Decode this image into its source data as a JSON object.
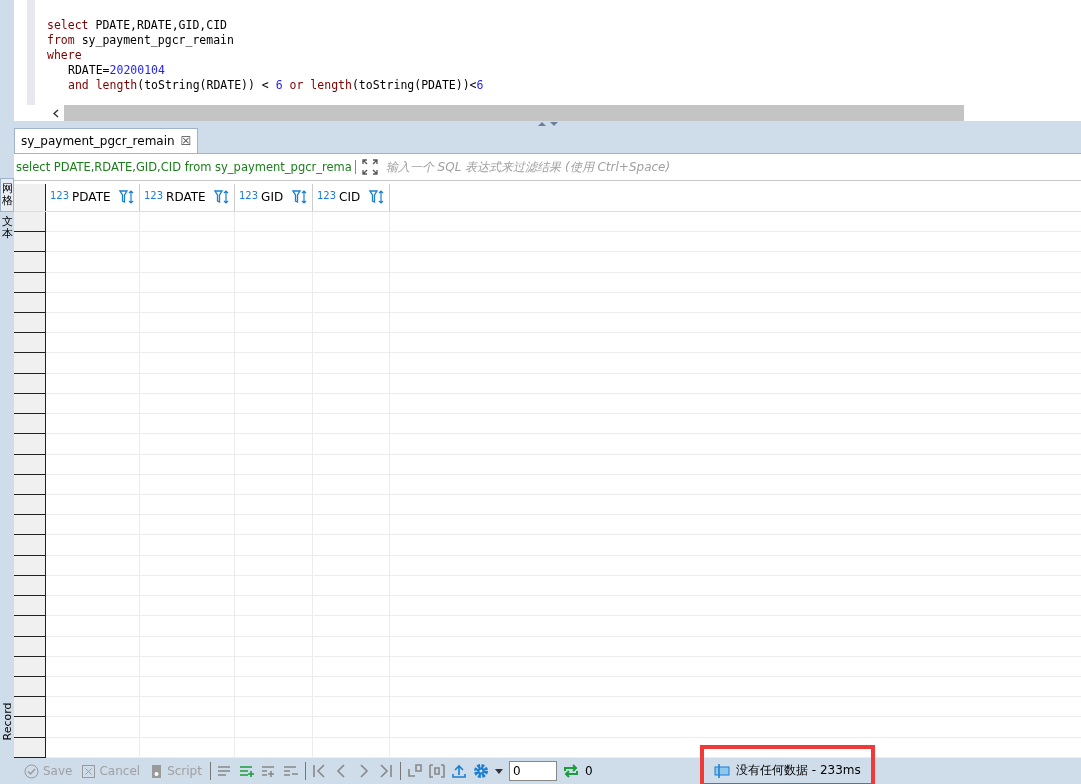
{
  "editor": {
    "lines": [
      {
        "indented": false,
        "tokens": [
          {
            "kind": "keyword",
            "text": "select"
          },
          {
            "kind": "ident",
            "text": " PDATE,RDATE,GID,CID"
          }
        ]
      },
      {
        "indented": false,
        "tokens": [
          {
            "kind": "keyword",
            "text": "from"
          },
          {
            "kind": "ident",
            "text": " sy_payment_pgcr_remain"
          }
        ]
      },
      {
        "indented": false,
        "tokens": [
          {
            "kind": "keyword",
            "text": "where"
          }
        ]
      },
      {
        "indented": true,
        "tokens": [
          {
            "kind": "ident",
            "text": "RDATE="
          },
          {
            "kind": "number",
            "text": "20200104"
          }
        ]
      },
      {
        "indented": true,
        "tokens": [
          {
            "kind": "keyword",
            "text": "and length"
          },
          {
            "kind": "ident",
            "text": "(toString(RDATE)) < "
          },
          {
            "kind": "number",
            "text": "6"
          },
          {
            "kind": "keyword",
            "text": " or length"
          },
          {
            "kind": "ident",
            "text": "(toString(PDATE))<"
          },
          {
            "kind": "number",
            "text": "6"
          }
        ]
      }
    ]
  },
  "tabs": [
    {
      "label": "sy_payment_pgcr_remain",
      "selected": true,
      "close": "☒"
    }
  ],
  "filter": {
    "query": "select PDATE,RDATE,GID,CID from sy_payment_pgcr_rema",
    "placeholder": "输入一个 SQL 表达式来过滤结果 (使用 Ctrl+Space)"
  },
  "side_tabs": [
    {
      "label": "网格",
      "kind": "cjk",
      "selected": true
    },
    {
      "label": "文本",
      "kind": "cjk",
      "selected": false
    },
    {
      "label": "Record",
      "kind": "latin",
      "selected": false
    }
  ],
  "table": {
    "columns": [
      {
        "type": "123",
        "name": "PDATE"
      },
      {
        "type": "123",
        "name": "RDATE"
      },
      {
        "type": "123",
        "name": "GID"
      },
      {
        "type": "123",
        "name": "CID"
      }
    ]
  },
  "toolbar": {
    "buttons": [
      {
        "label": "Save",
        "disabled": true
      },
      {
        "label": "Cancel",
        "disabled": true
      },
      {
        "label": "Script",
        "disabled": true
      }
    ],
    "page_value": "0",
    "refresh_count": "0",
    "status": "没有任何数据 - 233ms"
  }
}
